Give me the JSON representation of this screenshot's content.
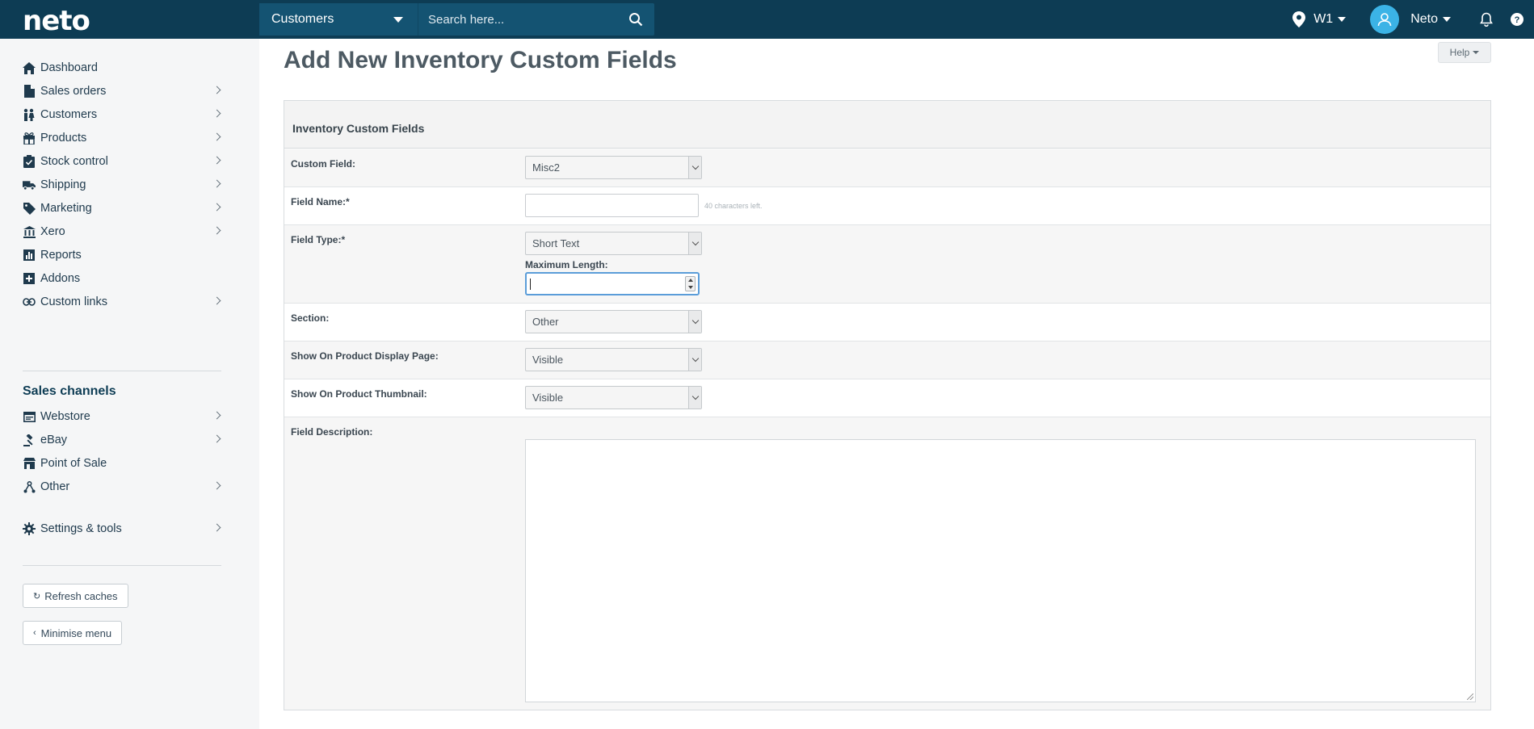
{
  "topbar": {
    "logo": "neto",
    "search_scope": "Customers",
    "search_placeholder": "Search here...",
    "location": "W1",
    "user": "Neto"
  },
  "sidebar": {
    "items": [
      {
        "label": "Dashboard",
        "icon": "home-icon"
      },
      {
        "label": "Sales orders",
        "icon": "document-icon"
      },
      {
        "label": "Customers",
        "icon": "people-icon"
      },
      {
        "label": "Products",
        "icon": "gift-icon"
      },
      {
        "label": "Stock control",
        "icon": "clipboard-check-icon"
      },
      {
        "label": "Shipping",
        "icon": "truck-icon"
      },
      {
        "label": "Marketing",
        "icon": "tag-icon"
      },
      {
        "label": "Xero",
        "icon": "bank-icon"
      },
      {
        "label": "Reports",
        "icon": "chart-icon"
      },
      {
        "label": "Addons",
        "icon": "plus-square-icon"
      },
      {
        "label": "Custom links",
        "icon": "link-icon"
      }
    ],
    "sales_channels_title": "Sales channels",
    "channels": [
      {
        "label": "Webstore",
        "icon": "browser-icon"
      },
      {
        "label": "eBay",
        "icon": "gavel-icon"
      },
      {
        "label": "Point of Sale",
        "icon": "store-icon"
      },
      {
        "label": "Other",
        "icon": "network-icon"
      }
    ],
    "settings_label": "Settings & tools",
    "refresh_label": "Refresh caches",
    "minimise_label": "Minimise menu"
  },
  "page": {
    "title": "Add New Inventory Custom Fields",
    "help_label": "Help",
    "panel_title": "Inventory Custom Fields",
    "fields": {
      "custom_field_label": "Custom Field:",
      "custom_field_value": "Misc2",
      "field_name_label": "Field Name:*",
      "field_name_value": "",
      "field_name_hint": "40 characters left.",
      "field_type_label": "Field Type:*",
      "field_type_value": "Short Text",
      "max_length_label": "Maximum Length:",
      "section_label": "Section:",
      "section_value": "Other",
      "show_display_label": "Show On Product Display Page:",
      "show_display_value": "Visible",
      "show_thumb_label": "Show On Product Thumbnail:",
      "show_thumb_value": "Visible",
      "description_label": "Field Description:"
    }
  }
}
